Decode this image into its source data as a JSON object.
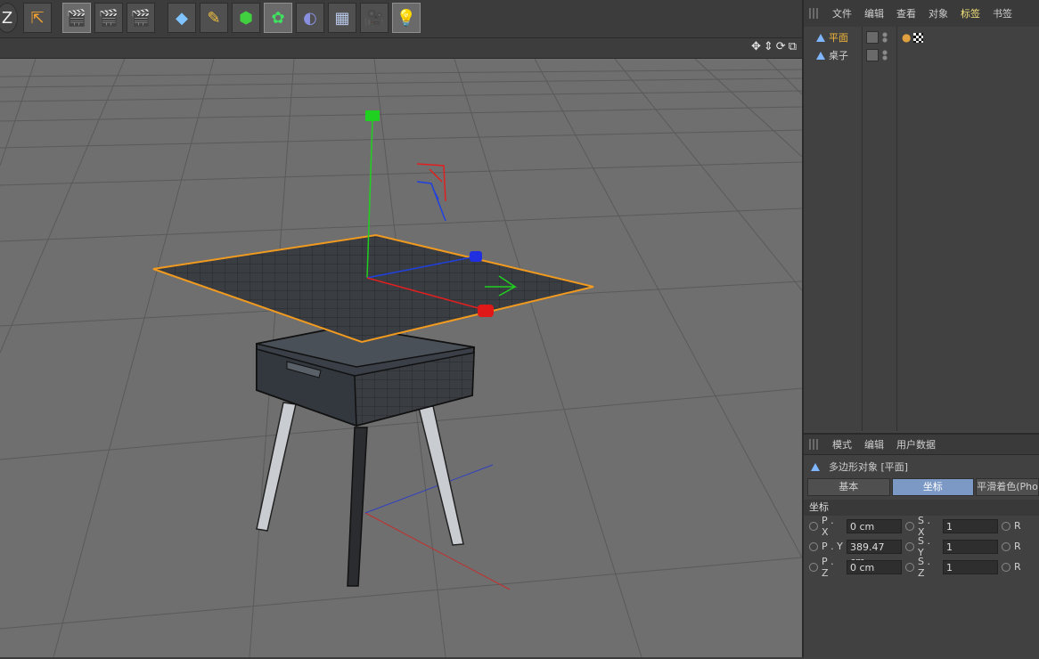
{
  "colors": {
    "accent_selected": "#f3b53a",
    "tab_active": "#7c98c4",
    "menu_active": "#f3e27a",
    "axis_x": "#e02020",
    "axis_y": "#20d020",
    "axis_z": "#2040e0",
    "selection_outline": "#f09a20"
  },
  "toolbar": {
    "buttons": [
      {
        "name": "logo-z-icon",
        "glyph": "Z"
      },
      {
        "name": "coordinate-axis-icon",
        "glyph": "⇱"
      },
      {
        "name": "render-view-icon",
        "glyph": "🎬"
      },
      {
        "name": "render-picture-viewer-icon",
        "glyph": "🎬"
      },
      {
        "name": "render-settings-icon",
        "glyph": "🎬"
      },
      {
        "name": "cube-primitive-icon",
        "glyph": "◆"
      },
      {
        "name": "pen-spline-icon",
        "glyph": "✎"
      },
      {
        "name": "subdivision-surface-icon",
        "glyph": "⬢"
      },
      {
        "name": "cloner-mograph-icon",
        "glyph": "✿"
      },
      {
        "name": "deformer-icon",
        "glyph": "◐"
      },
      {
        "name": "floor-environment-icon",
        "glyph": "▦"
      },
      {
        "name": "camera-icon",
        "glyph": "🎥"
      },
      {
        "name": "light-icon",
        "glyph": "💡"
      }
    ]
  },
  "viewport": {
    "nav_icons": [
      "✥",
      "⇕",
      "⟳",
      "⧉"
    ]
  },
  "object_manager": {
    "menu": [
      "文件",
      "编辑",
      "查看",
      "对象",
      "标签",
      "书签"
    ],
    "active_menu": "标签",
    "objects": [
      {
        "name": "平面",
        "selected": true
      },
      {
        "name": "桌子",
        "selected": false
      }
    ]
  },
  "attribute_manager": {
    "menu": [
      "模式",
      "编辑",
      "用户数据"
    ],
    "title": "多边形对象 [平面]",
    "tabs": [
      {
        "label": "基本",
        "active": false
      },
      {
        "label": "坐标",
        "active": true
      },
      {
        "label": "平滑着色(Pho",
        "active": false
      }
    ],
    "section": "坐标",
    "rows": [
      {
        "p_label": "P . X",
        "p_value": "0 cm",
        "s_label": "S . X",
        "s_value": "1",
        "r_label": "R"
      },
      {
        "p_label": "P . Y",
        "p_value": "389.47 cm",
        "s_label": "S . Y",
        "s_value": "1",
        "r_label": "R"
      },
      {
        "p_label": "P . Z",
        "p_value": "0 cm",
        "s_label": "S . Z",
        "s_value": "1",
        "r_label": "R"
      }
    ]
  }
}
